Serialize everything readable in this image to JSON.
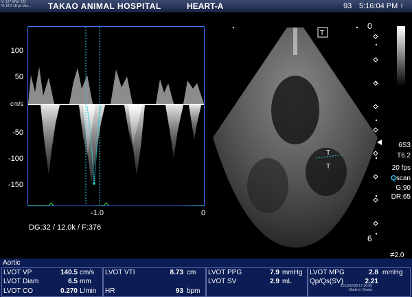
{
  "header": {
    "tiny_text": "V: 127 WW: 222\n% 18 2 18 px Vas...",
    "hospital": "TAKAO ANIMAL HOSPITAL",
    "preset": "HEART-A",
    "number": "93",
    "time": "5:16:04 PM",
    "logo": "i"
  },
  "doppler": {
    "y_unit": "cm/s",
    "y_ticks": [
      "100",
      "50",
      "-50",
      "-100",
      "-150"
    ],
    "x_ticks": [
      "-1.0",
      "0"
    ],
    "params": "DG:32  / 12.0k  / F:376"
  },
  "image_right": {
    "depth_top": "0",
    "depth_bottom": "6",
    "probe": "6S3",
    "tilt": "T6.2",
    "fps": "20 fps",
    "scan_q": "Q",
    "scan": "scan",
    "gain": "G:90",
    "dr": "DR:65",
    "focus": "2.0"
  },
  "measurements": {
    "title": "Aortic",
    "col1": [
      {
        "label": "LVOT VP",
        "value": "140.5",
        "unit": "cm/s"
      },
      {
        "label": "LVOT Diam",
        "value": "6.5",
        "unit": "mm"
      },
      {
        "label": "LVOT CO",
        "value": "0.270",
        "unit": "L/min"
      }
    ],
    "col2": [
      {
        "label": "LVOT VTI",
        "value": "8.73",
        "unit": "cm"
      },
      {
        "label": "",
        "value": "",
        "unit": ""
      },
      {
        "label": "HR",
        "value": "93",
        "unit": "bpm"
      }
    ],
    "col3": [
      {
        "label": "LVOT PPG",
        "value": "7.9",
        "unit": "mmHg"
      },
      {
        "label": "LVOT SV",
        "value": "2.9",
        "unit": "mL"
      }
    ],
    "col4": [
      {
        "label": "LVOT MPG",
        "value": "2.8",
        "unit": "mmHg"
      },
      {
        "label": "Qp/Qs(SV)",
        "value": "2.21",
        "unit": ""
      }
    ]
  },
  "footer": {
    "line1": "2013/02/08 17:16:05",
    "line2": "Made in Osaka"
  }
}
